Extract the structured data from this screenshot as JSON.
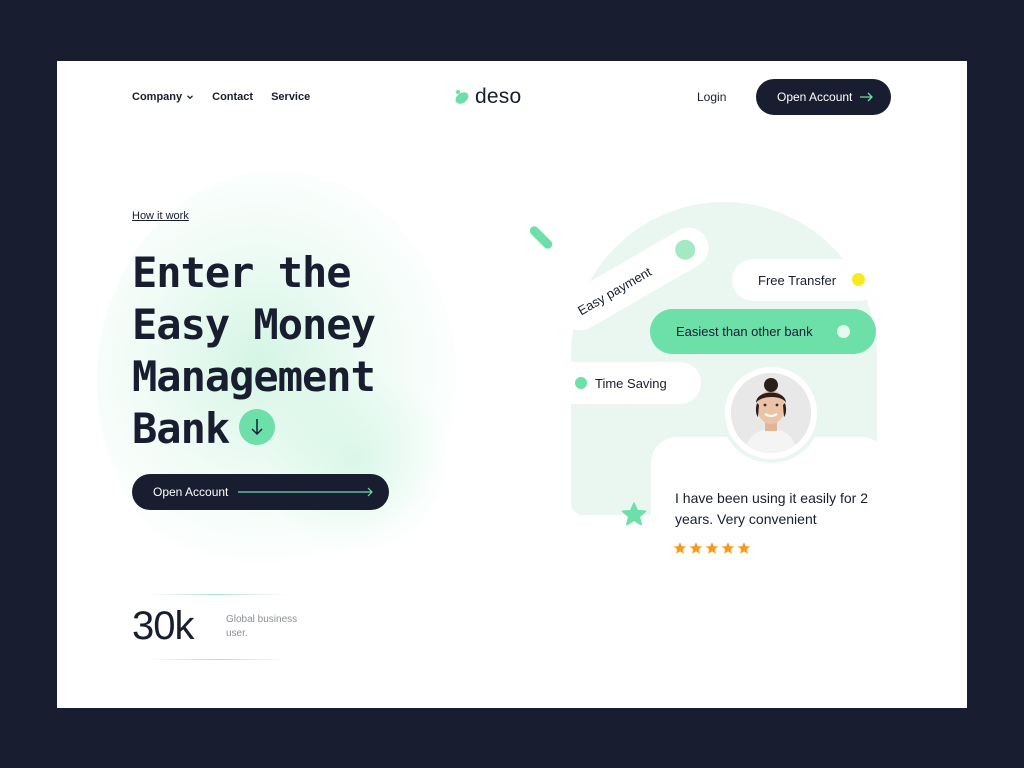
{
  "nav": {
    "company": "Company",
    "contact": "Contact",
    "service": "Service",
    "login": "Login",
    "open_account": "Open Account"
  },
  "logo": {
    "text": "deso"
  },
  "hero": {
    "eyebrow": "How it work",
    "headline": [
      "Enter the",
      "Easy Money",
      "Management",
      "Bank"
    ],
    "cta": "Open Account"
  },
  "stat": {
    "value": "30k",
    "description": "Global business user."
  },
  "features": {
    "easy_payment": "Easy payment",
    "free_transfer": "Free Transfer",
    "easiest": "Easiest than other bank",
    "time_saving": "Time Saving"
  },
  "testimonial": {
    "quote": "I have been using it easily for 2 years. Very convenient",
    "rating": 5
  },
  "colors": {
    "dark": "#181e30",
    "accent_green": "#6ddfa8",
    "light_green": "#eaf7f0",
    "yellow": "#f6eb1e",
    "star_orange": "#f59a1b"
  }
}
